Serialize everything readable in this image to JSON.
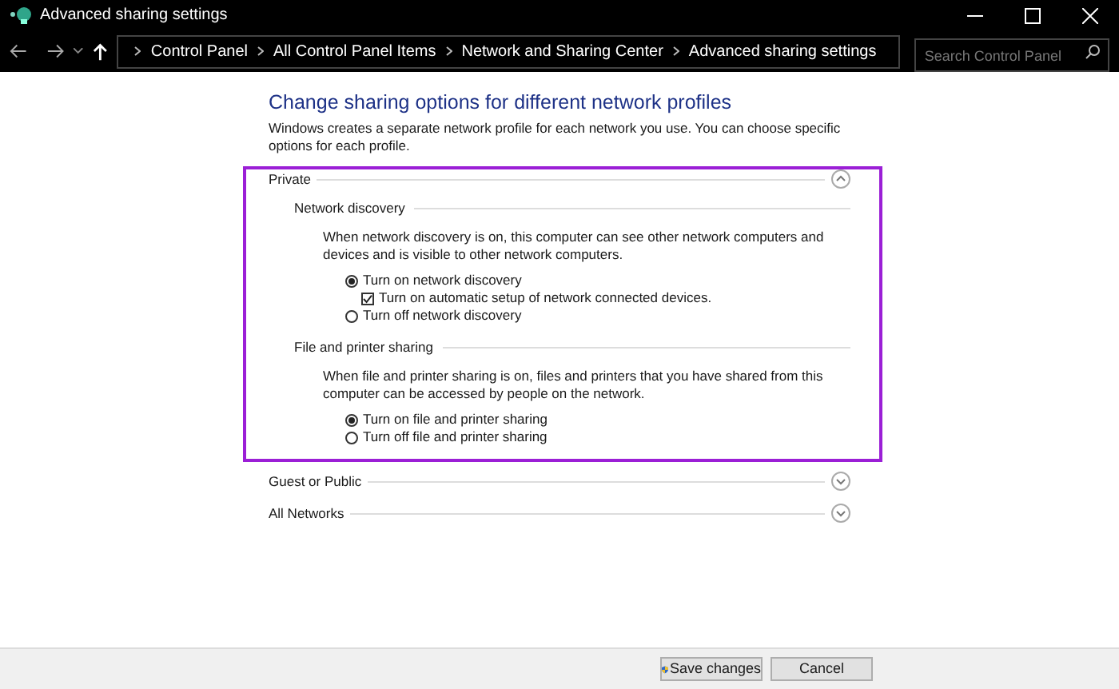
{
  "window": {
    "title": "Advanced sharing settings"
  },
  "breadcrumb": [
    "Control Panel",
    "All Control Panel Items",
    "Network and Sharing Center",
    "Advanced sharing settings"
  ],
  "search": {
    "placeholder": "Search Control Panel"
  },
  "heading": "Change sharing options for different network profiles",
  "description": "Windows creates a separate network profile for each network you use. You can choose specific options for each profile.",
  "profiles": [
    {
      "name": "Private",
      "expanded": true,
      "highlighted": true,
      "sections": [
        {
          "title": "Network discovery",
          "description": "When network discovery is on, this computer can see other network computers and devices and is visible to other network computers.",
          "options": [
            {
              "label": "Turn on network discovery",
              "selected": true,
              "children": [
                {
                  "label": "Turn on automatic setup of network connected devices.",
                  "checked": true
                }
              ]
            },
            {
              "label": "Turn off network discovery",
              "selected": false
            }
          ]
        },
        {
          "title": "File and printer sharing",
          "description": "When file and printer sharing is on, files and printers that you have shared from this computer can be accessed by people on the network.",
          "options": [
            {
              "label": "Turn on file and printer sharing",
              "selected": true
            },
            {
              "label": "Turn off file and printer sharing",
              "selected": false
            }
          ]
        }
      ]
    },
    {
      "name": "Guest or Public",
      "expanded": false,
      "highlighted": false
    },
    {
      "name": "All Networks",
      "expanded": false,
      "highlighted": false
    }
  ],
  "buttons": [
    {
      "kind": "shield",
      "label": "Save changes"
    },
    {
      "kind": "plain",
      "label": "Cancel"
    }
  ]
}
